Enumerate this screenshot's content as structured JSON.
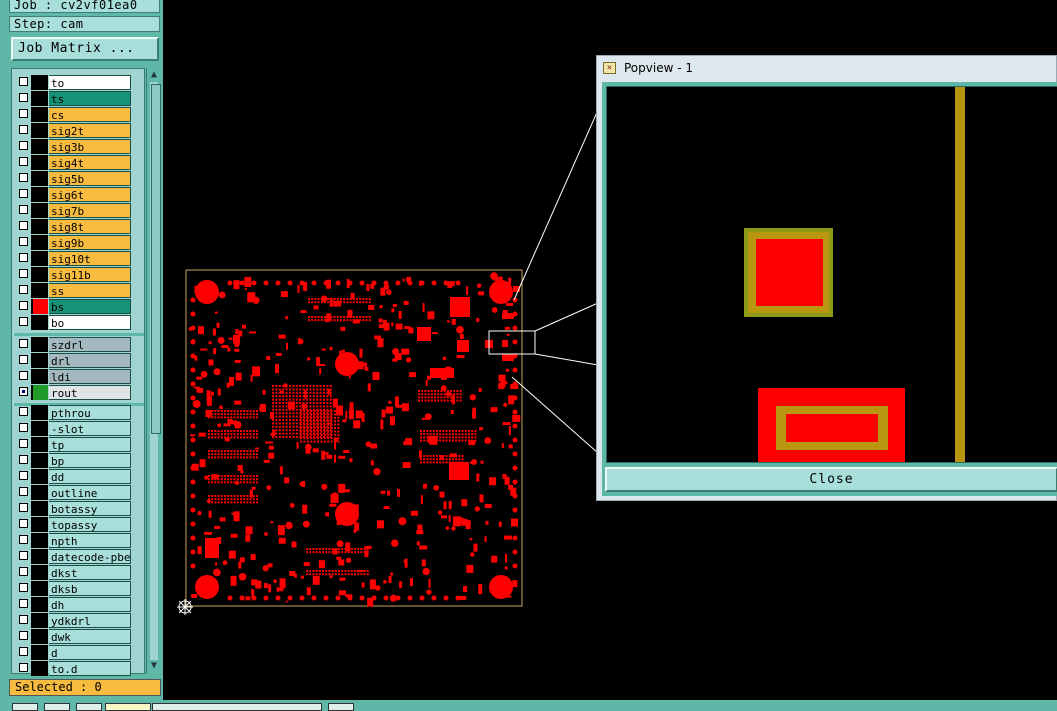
{
  "header": {
    "job_label": "Job : cv2vf01ea0",
    "step_label": "Step: cam",
    "job_matrix_button": "Job Matrix ..."
  },
  "layers_board": [
    {
      "name": "to",
      "color": "#ffffff"
    },
    {
      "name": "ts",
      "color": "#169276"
    },
    {
      "name": "cs",
      "color": "#f6bb3f"
    },
    {
      "name": "sig2t",
      "color": "#f6bb3f"
    },
    {
      "name": "sig3b",
      "color": "#f6bb3f"
    },
    {
      "name": "sig4t",
      "color": "#f6bb3f"
    },
    {
      "name": "sig5b",
      "color": "#f6bb3f"
    },
    {
      "name": "sig6t",
      "color": "#f6bb3f"
    },
    {
      "name": "sig7b",
      "color": "#f6bb3f"
    },
    {
      "name": "sig8t",
      "color": "#f6bb3f"
    },
    {
      "name": "sig9b",
      "color": "#f6bb3f"
    },
    {
      "name": "sig10t",
      "color": "#f6bb3f"
    },
    {
      "name": "sig11b",
      "color": "#f6bb3f"
    },
    {
      "name": "ss",
      "color": "#f6bb3f"
    },
    {
      "name": "bs",
      "color": "#169276",
      "display_color": "#ff0000"
    },
    {
      "name": "bo",
      "color": "#ffffff"
    }
  ],
  "layers_drill": [
    {
      "name": "szdrl",
      "color": "#a4b8bf"
    },
    {
      "name": "drl",
      "color": "#a4b8bf"
    },
    {
      "name": "ldi",
      "color": "#a4b8bf"
    },
    {
      "name": "rout",
      "color": "#dfe4e4",
      "display_color": "#209a29",
      "active": true,
      "marker": "⊞"
    }
  ],
  "layers_misc": [
    {
      "name": "pthrou",
      "color": "#a9dfdb"
    },
    {
      "name": "-slot",
      "color": "#a9dfdb"
    },
    {
      "name": "tp",
      "color": "#a9dfdb"
    },
    {
      "name": "bp",
      "color": "#a9dfdb"
    },
    {
      "name": "dd",
      "color": "#a9dfdb"
    },
    {
      "name": "outline",
      "color": "#a9dfdb"
    },
    {
      "name": "botassy",
      "color": "#a9dfdb"
    },
    {
      "name": "topassy",
      "color": "#a9dfdb"
    },
    {
      "name": "npth",
      "color": "#a9dfdb"
    },
    {
      "name": "datecode-pbe",
      "color": "#a9dfdb"
    },
    {
      "name": "dkst",
      "color": "#a9dfdb"
    },
    {
      "name": "dksb",
      "color": "#a9dfdb"
    },
    {
      "name": "dh",
      "color": "#a9dfdb"
    },
    {
      "name": "ydkdrl",
      "color": "#a9dfdb"
    },
    {
      "name": "dwk",
      "color": "#a9dfdb"
    },
    {
      "name": "d",
      "color": "#a9dfdb"
    },
    {
      "name": "to.d",
      "color": "#a9dfdb",
      "marker": "◆"
    }
  ],
  "status": {
    "selected_label": "Selected : 0"
  },
  "popview": {
    "title": "Popview - 1",
    "close_label": "Close"
  },
  "colors": {
    "panel": "#5fb8a7",
    "layer_yellow": "#f6bb3f",
    "layer_teal": "#169276",
    "copper": "#ff0000",
    "pad_gold": "#b8960f"
  }
}
